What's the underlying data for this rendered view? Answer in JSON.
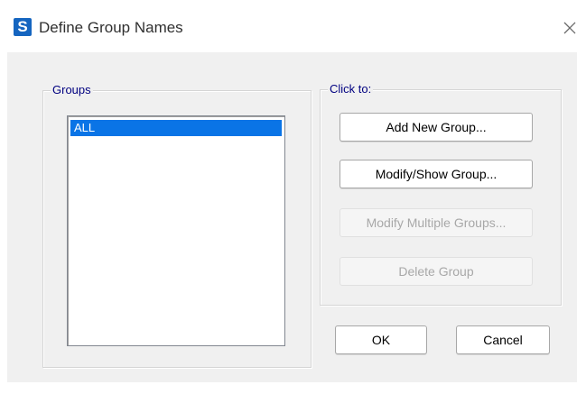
{
  "window": {
    "title": "Define Group Names",
    "app_icon_letter": "S",
    "app_icon_color": "#1565c0",
    "close_icon": "close-icon"
  },
  "groups_panel": {
    "legend": "Groups",
    "items": [
      {
        "label": "ALL",
        "selected": true
      }
    ]
  },
  "actions_panel": {
    "legend": "Click to:",
    "buttons": {
      "add": {
        "label": "Add New Group...",
        "enabled": true
      },
      "modify_show": {
        "label": "Modify/Show Group...",
        "enabled": true
      },
      "modify_multiple": {
        "label": "Modify Multiple Groups...",
        "enabled": false
      },
      "delete": {
        "label": "Delete Group",
        "enabled": false
      }
    }
  },
  "footer": {
    "ok_label": "OK",
    "cancel_label": "Cancel"
  },
  "colors": {
    "selection": "#0a74e6",
    "legend_text": "#000080",
    "client_background": "#f0f0f0"
  }
}
